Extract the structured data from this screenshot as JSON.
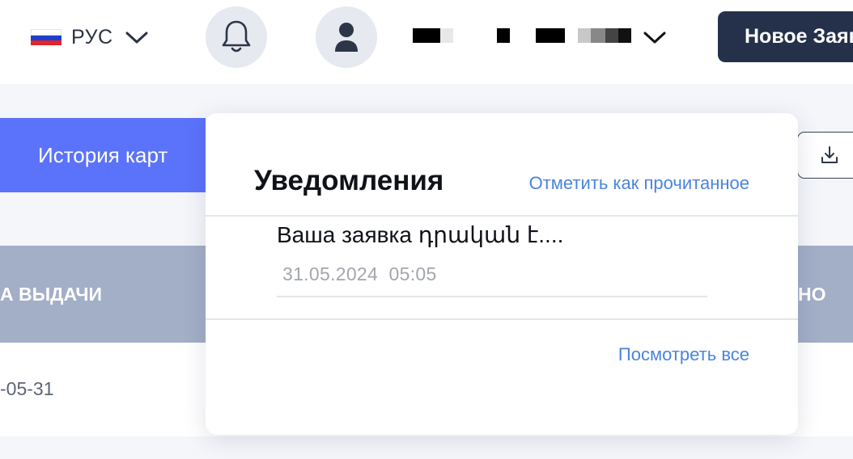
{
  "header": {
    "language": {
      "label": "РУС",
      "flag_colors": [
        "#ffffff",
        "#1c3fd1",
        "#e0252b"
      ],
      "icon": "chevron-down-icon"
    },
    "notifications_icon": "bell-icon",
    "profile_icon": "user-icon",
    "user_menu_icon": "chevron-down-icon",
    "new_request_label": "Новое Заявка"
  },
  "tabs": {
    "history_label": "История карт"
  },
  "toolbar": {
    "download_icon": "download-icon"
  },
  "table": {
    "headers": [
      "А ВЫДАЧИ",
      "НО"
    ],
    "rows": [
      {
        "date": "-05-31"
      }
    ]
  },
  "notifications": {
    "title": "Уведомления",
    "mark_read_label": "Отметить как прочитанное",
    "items": [
      {
        "text": "Ваша заявка դրական է....",
        "date": "31.05.2024",
        "time": "05:05"
      }
    ],
    "view_all_label": "Посмотреть все"
  },
  "colors": {
    "accent_blue": "#5b72fb",
    "dark_button": "#25304a",
    "link": "#4a84dd",
    "table_header": "#a3aec7"
  }
}
